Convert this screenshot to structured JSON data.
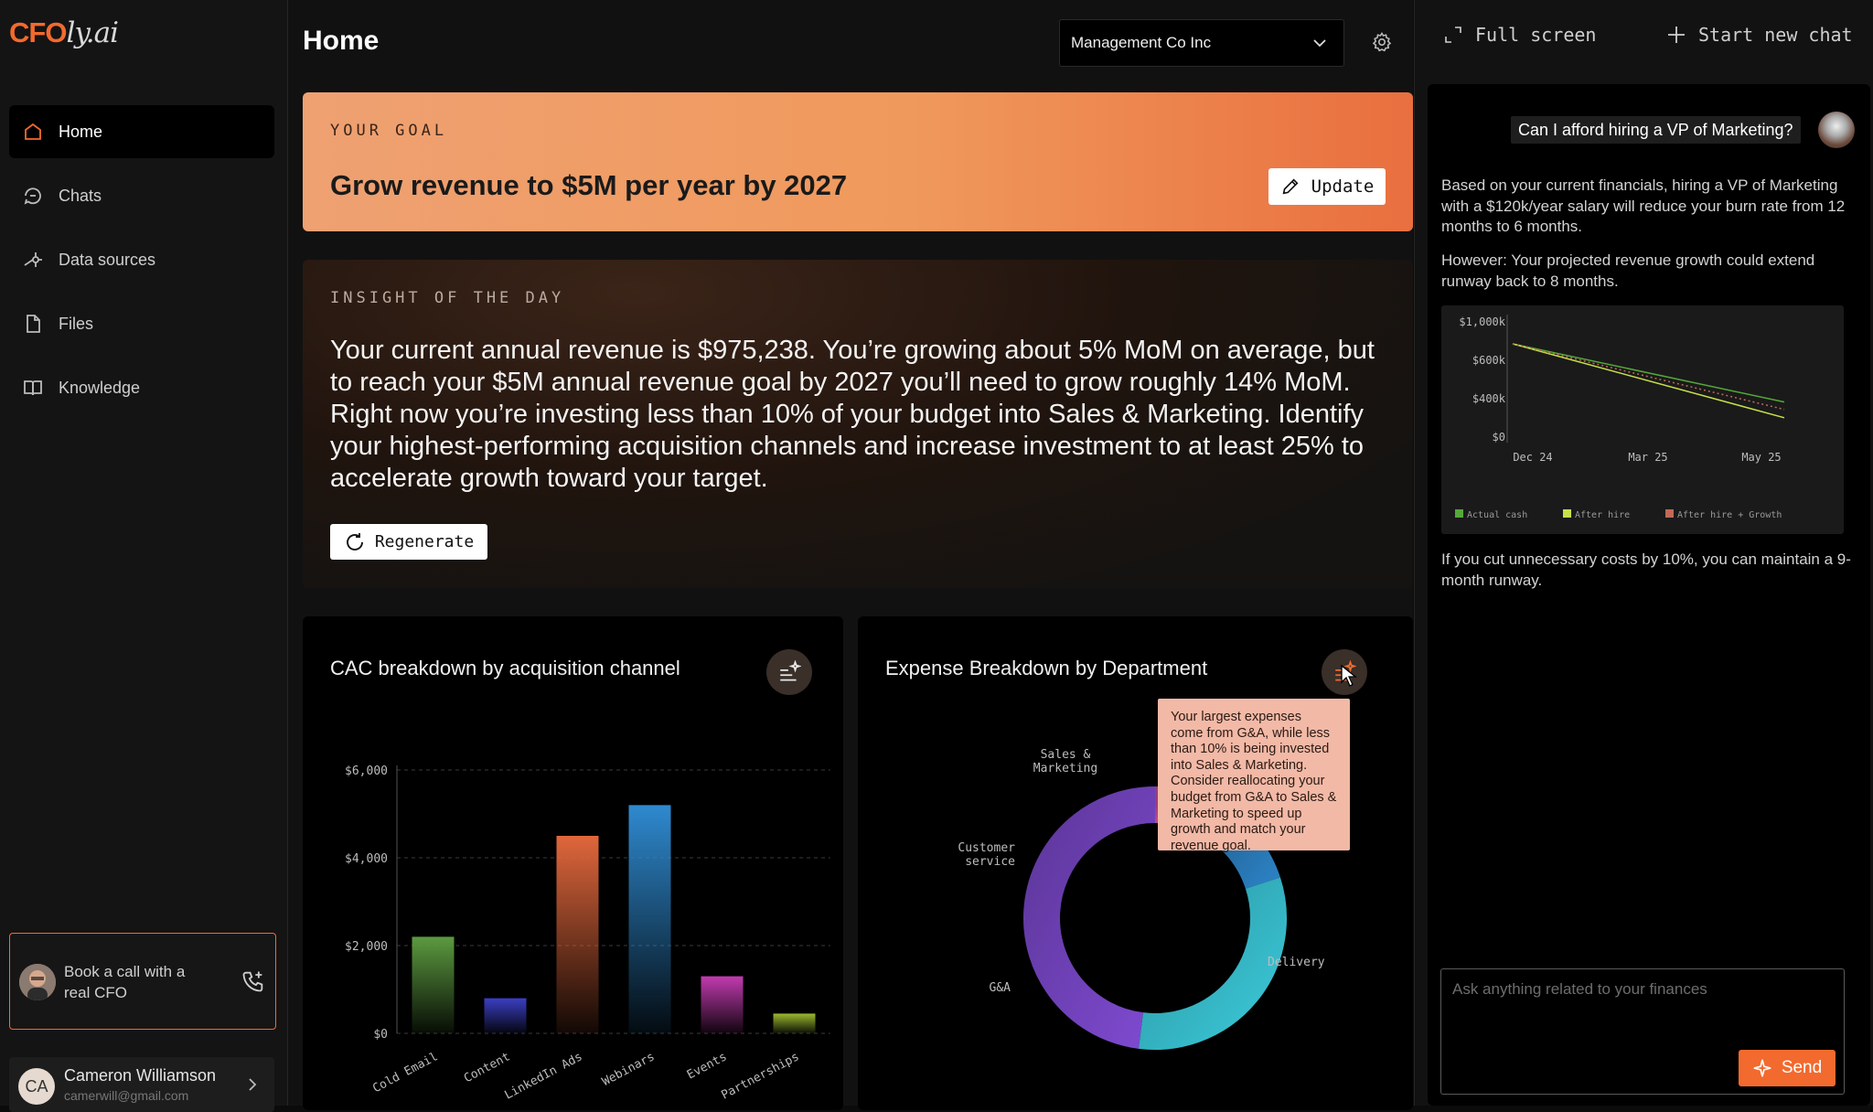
{
  "brand": {
    "logo_main": "CFO",
    "logo_tail": "ly.ai",
    "accent": "#f26a2e"
  },
  "sidebar": {
    "items": [
      {
        "label": "Home",
        "icon": "home-icon",
        "active": true
      },
      {
        "label": "Chats",
        "icon": "chat-history-icon"
      },
      {
        "label": "Data sources",
        "icon": "data-sources-icon"
      },
      {
        "label": "Files",
        "icon": "file-icon"
      },
      {
        "label": "Knowledge",
        "icon": "book-icon"
      }
    ],
    "book_call": "Book a call with a real CFO",
    "user": {
      "initials": "CA",
      "name": "Cameron Williamson",
      "email": "camerwill@gmail.com"
    }
  },
  "header": {
    "title": "Home",
    "company": "Management Co Inc"
  },
  "goal": {
    "kicker": "YOUR GOAL",
    "text": "Grow revenue to $5M per year by 2027",
    "button": "Update"
  },
  "insight": {
    "kicker": "INSIGHT OF THE DAY",
    "text": "Your current annual revenue is $975,238. You’re growing about 5% MoM on average, but to reach your $5M annual revenue goal by 2027 you’ll need to grow roughly 14% MoM. Right now you’re investing less than 10% of your budget into Sales & Marketing. Identify your highest-performing acquisition channels and increase investment to at least 25% to accelerate growth toward your target.",
    "button": "Regenerate"
  },
  "cac_panel": {
    "title": "CAC breakdown by acquisition channel"
  },
  "expense_panel": {
    "title": "Expense Breakdown by Department",
    "tooltip": "Your largest expenses come from G&A, while less than 10% is being invested into Sales & Marketing. Consider reallocating your budget from G&A to Sales & Marketing to speed up growth and match your revenue goal."
  },
  "chat": {
    "full_screen": "Full screen",
    "new_chat": "Start new chat",
    "user_message": "Can I afford hiring a VP of Marketing?",
    "reply_1": "Based on your current financials, hiring a VP of Marketing with a $120k/year salary will reduce your burn rate from 12 months to 6 months.",
    "reply_2": "However: Your projected revenue growth could extend runway back to 8 months.",
    "reply_3": "If you cut unnecessary costs by 10%, you can maintain a 9-month runway.",
    "input_placeholder": "Ask anything related to your finances",
    "send": "Send"
  },
  "chart_data": [
    {
      "type": "bar",
      "categories": [
        "Cold Email",
        "Content",
        "LinkedIn Ads",
        "Webinars",
        "Events",
        "Partnerships"
      ],
      "values": [
        2200,
        800,
        4500,
        5200,
        1300,
        450
      ],
      "colors": [
        "#5c9a40",
        "#3b3fc4",
        "#e0673c",
        "#2f8ad0",
        "#c23bb0",
        "#9ab82f"
      ],
      "yticks": [
        "$6,000",
        "$4,000",
        "$2,000",
        "$0"
      ],
      "ylim": [
        0,
        6000
      ],
      "grid": true
    },
    {
      "type": "pie",
      "labels": [
        "Sales & Marketing",
        "Customer service",
        "G&A",
        "Delivery"
      ],
      "values": [
        0.08,
        0.12,
        0.32,
        0.48
      ],
      "colors": [
        "#d04fa6",
        "#2b7fc0",
        "#3ac6d6",
        "#7e4ad0"
      ]
    },
    {
      "type": "line",
      "x": [
        "Dec 24",
        "Mar 25",
        "May 25"
      ],
      "yticks": [
        "$1,000k",
        "$600k",
        "$400k",
        "$0"
      ],
      "series": [
        {
          "name": "Actual cash",
          "color": "#55a83a",
          "start": 1000,
          "end": 370
        },
        {
          "name": "After hire",
          "color": "#c8e04a",
          "start": 1000,
          "end": 200
        },
        {
          "name": "After hire + Growth",
          "color": "#c06a55",
          "start": 1000,
          "end": 290
        }
      ]
    }
  ]
}
